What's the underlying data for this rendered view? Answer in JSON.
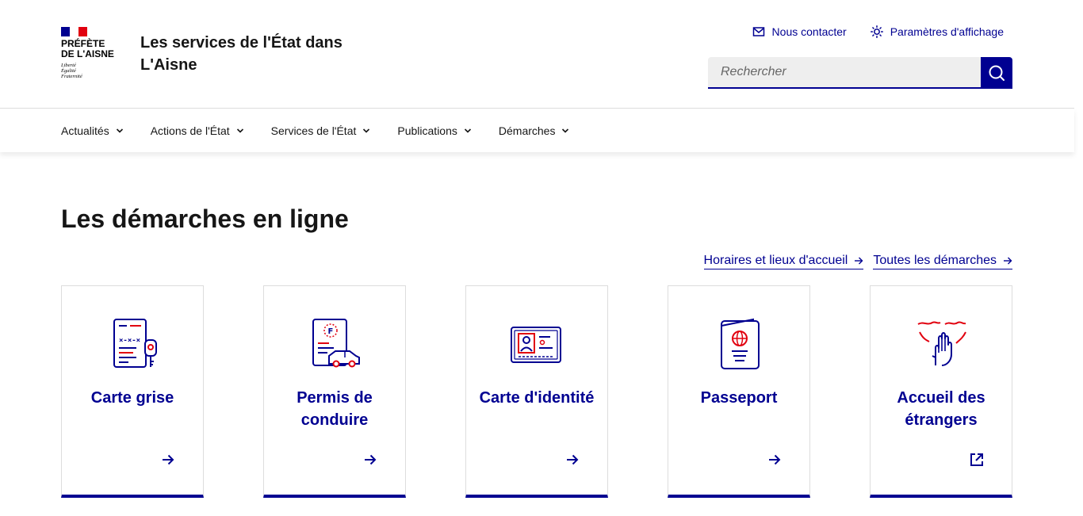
{
  "header": {
    "logo": {
      "prefecture_line1": "PRÉFÈTE",
      "prefecture_line2": "DE L'AISNE",
      "motto_line1": "Liberté",
      "motto_line2": "Égalité",
      "motto_line3": "Fraternité"
    },
    "site_title": "Les services de l'État dans L'Aisne",
    "tools": {
      "contact_label": "Nous contacter",
      "contact_icon": "mail-icon",
      "display_label": "Paramètres d'affichage",
      "display_icon": "sun-icon"
    },
    "search": {
      "placeholder": "Rechercher",
      "button_icon": "search-icon"
    }
  },
  "nav": {
    "items": [
      {
        "label": "Actualités"
      },
      {
        "label": "Actions de l'État"
      },
      {
        "label": "Services de l'État"
      },
      {
        "label": "Publications"
      },
      {
        "label": "Démarches"
      }
    ]
  },
  "main": {
    "title": "Les démarches en ligne",
    "links": [
      {
        "label": "Horaires et lieux d'accueil"
      },
      {
        "label": "Toutes les démarches"
      }
    ],
    "cards": [
      {
        "title": "Carte grise",
        "icon": "vehicle-registration-icon",
        "action_icon": "arrow-right-icon"
      },
      {
        "title": "Permis de conduire",
        "icon": "driving-license-icon",
        "action_icon": "arrow-right-icon"
      },
      {
        "title": "Carte d'identité",
        "icon": "id-card-icon",
        "action_icon": "arrow-right-icon"
      },
      {
        "title": "Passeport",
        "icon": "passport-icon",
        "action_icon": "arrow-right-icon"
      },
      {
        "title": "Accueil des étrangers",
        "icon": "welcome-hand-icon",
        "action_icon": "external-link-icon"
      }
    ]
  },
  "colors": {
    "primary_blue": "#000091",
    "accent_red": "#e1000f",
    "border_gray": "#dddddd",
    "input_bg": "#eeeeee"
  }
}
